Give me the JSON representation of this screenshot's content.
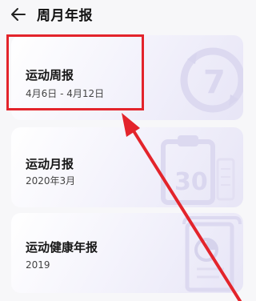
{
  "header": {
    "title": "周月年报"
  },
  "cards": [
    {
      "title": "运动周报",
      "subtitle": "4月6日 - 4月12日"
    },
    {
      "title": "运动月报",
      "subtitle": "2020年3月"
    },
    {
      "title": "运动健康年报",
      "subtitle": "2019"
    }
  ],
  "illustrations": {
    "weekly": "calendar-7-refresh-icon",
    "monthly": "calendar-30-clipboard-icon",
    "yearly": "document-pie-chart-icon"
  },
  "colors": {
    "highlight": "#e3242b",
    "card_tint": "#e7e5f6"
  }
}
